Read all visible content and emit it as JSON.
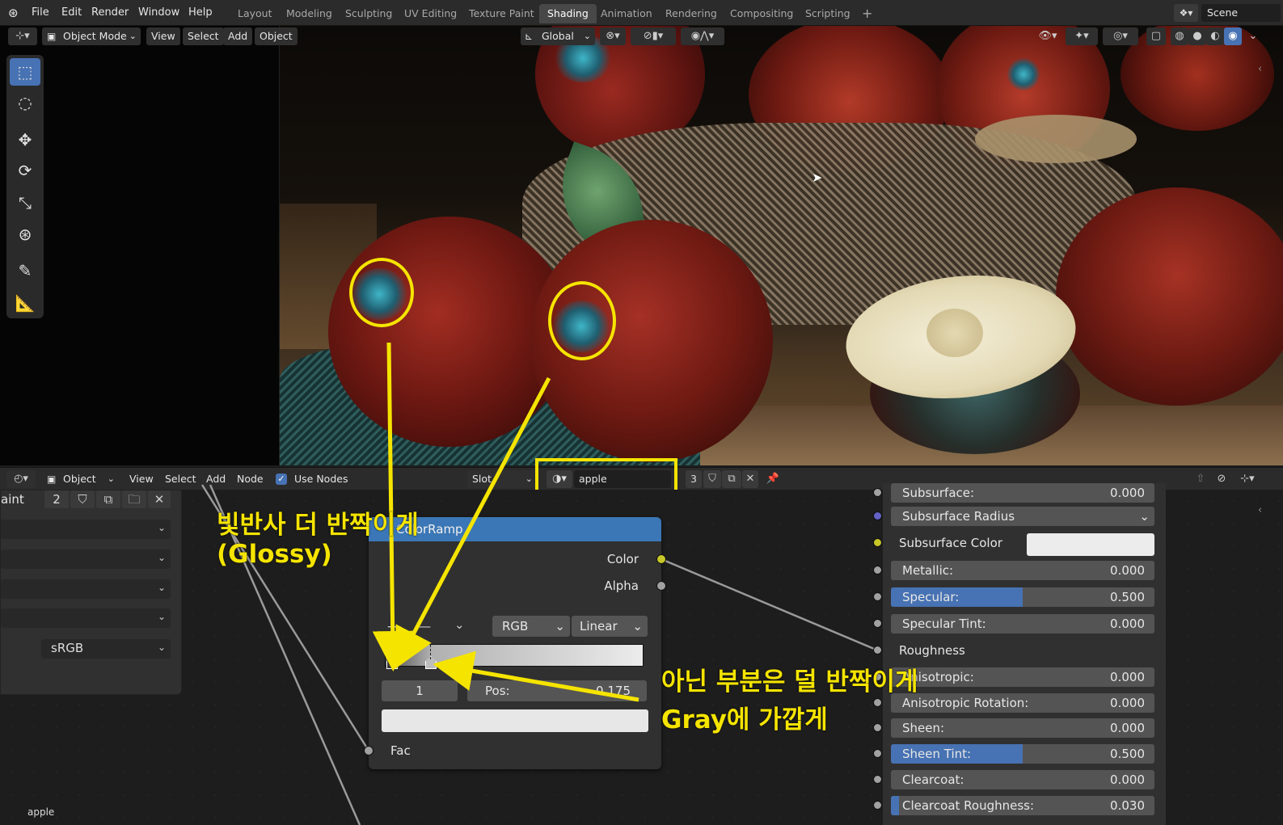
{
  "menu": [
    "File",
    "Edit",
    "Render",
    "Window",
    "Help"
  ],
  "workspaces": [
    "Layout",
    "Modeling",
    "Sculpting",
    "UV Editing",
    "Texture Paint",
    "Shading",
    "Animation",
    "Rendering",
    "Compositing",
    "Scripting"
  ],
  "active_workspace": "Shading",
  "add_workspace": "+",
  "scene_name": "Scene",
  "viewport": {
    "mode": "Object Mode",
    "menu": [
      "View",
      "Select",
      "Add",
      "Object"
    ],
    "orientation": "Global"
  },
  "node_editor": {
    "object_label": "Object",
    "menu": [
      "View",
      "Select",
      "Add",
      "Node"
    ],
    "use_nodes_label": "Use Nodes",
    "slot_label": "Slot",
    "material_name": "apple",
    "user_count": "3"
  },
  "side_panel": {
    "title_fragment": "aint",
    "image_users": "2",
    "colorspace": "sRGB",
    "bottom_label": "apple"
  },
  "colorramp": {
    "title": "ColorRamp",
    "output_color": "Color",
    "output_alpha": "Alpha",
    "color_mode": "RGB",
    "interpolation": "Linear",
    "stop_index": "1",
    "pos_label": "Pos:",
    "pos_value": "0.175",
    "input_fac": "Fac",
    "remove_stop": "—"
  },
  "principled": [
    {
      "label": "Subsurface:",
      "value": "0.000",
      "socket": "#a1a1a1",
      "kind": "value"
    },
    {
      "label": "Subsurface Radius",
      "value": "",
      "socket": "#6363c7",
      "kind": "dropdown"
    },
    {
      "label": "Subsurface Color",
      "value": "",
      "socket": "#c7c729",
      "kind": "color"
    },
    {
      "label": "Metallic:",
      "value": "0.000",
      "socket": "#a1a1a1",
      "kind": "value"
    },
    {
      "label": "Specular:",
      "value": "0.500",
      "socket": "#a1a1a1",
      "kind": "value",
      "fill": 0.5
    },
    {
      "label": "Specular Tint:",
      "value": "0.000",
      "socket": "#a1a1a1",
      "kind": "value"
    },
    {
      "label": "Roughness",
      "value": "",
      "socket": "#a1a1a1",
      "kind": "connected"
    },
    {
      "label": "Anisotropic:",
      "value": "0.000",
      "socket": "#a1a1a1",
      "kind": "value"
    },
    {
      "label": "Anisotropic Rotation:",
      "value": "0.000",
      "socket": "#a1a1a1",
      "kind": "value"
    },
    {
      "label": "Sheen:",
      "value": "0.000",
      "socket": "#a1a1a1",
      "kind": "value"
    },
    {
      "label": "Sheen Tint:",
      "value": "0.500",
      "socket": "#a1a1a1",
      "kind": "value",
      "fill": 0.5
    },
    {
      "label": "Clearcoat:",
      "value": "0.000",
      "socket": "#a1a1a1",
      "kind": "value"
    },
    {
      "label": "Clearcoat Roughness:",
      "value": "0.030",
      "socket": "#a1a1a1",
      "kind": "value",
      "fill": 0.03
    }
  ],
  "annotations": {
    "glossy_line1": "빛반사 더 반짝이게",
    "glossy_line2": "(Glossy)",
    "gray_line1": "아닌 부분은 덜 반짝이게",
    "gray_line2": "Gray에 가깝게"
  },
  "colors": {
    "accent": "#4772b3",
    "node_header": "#3b77b6",
    "annotation": "#f5e400"
  }
}
